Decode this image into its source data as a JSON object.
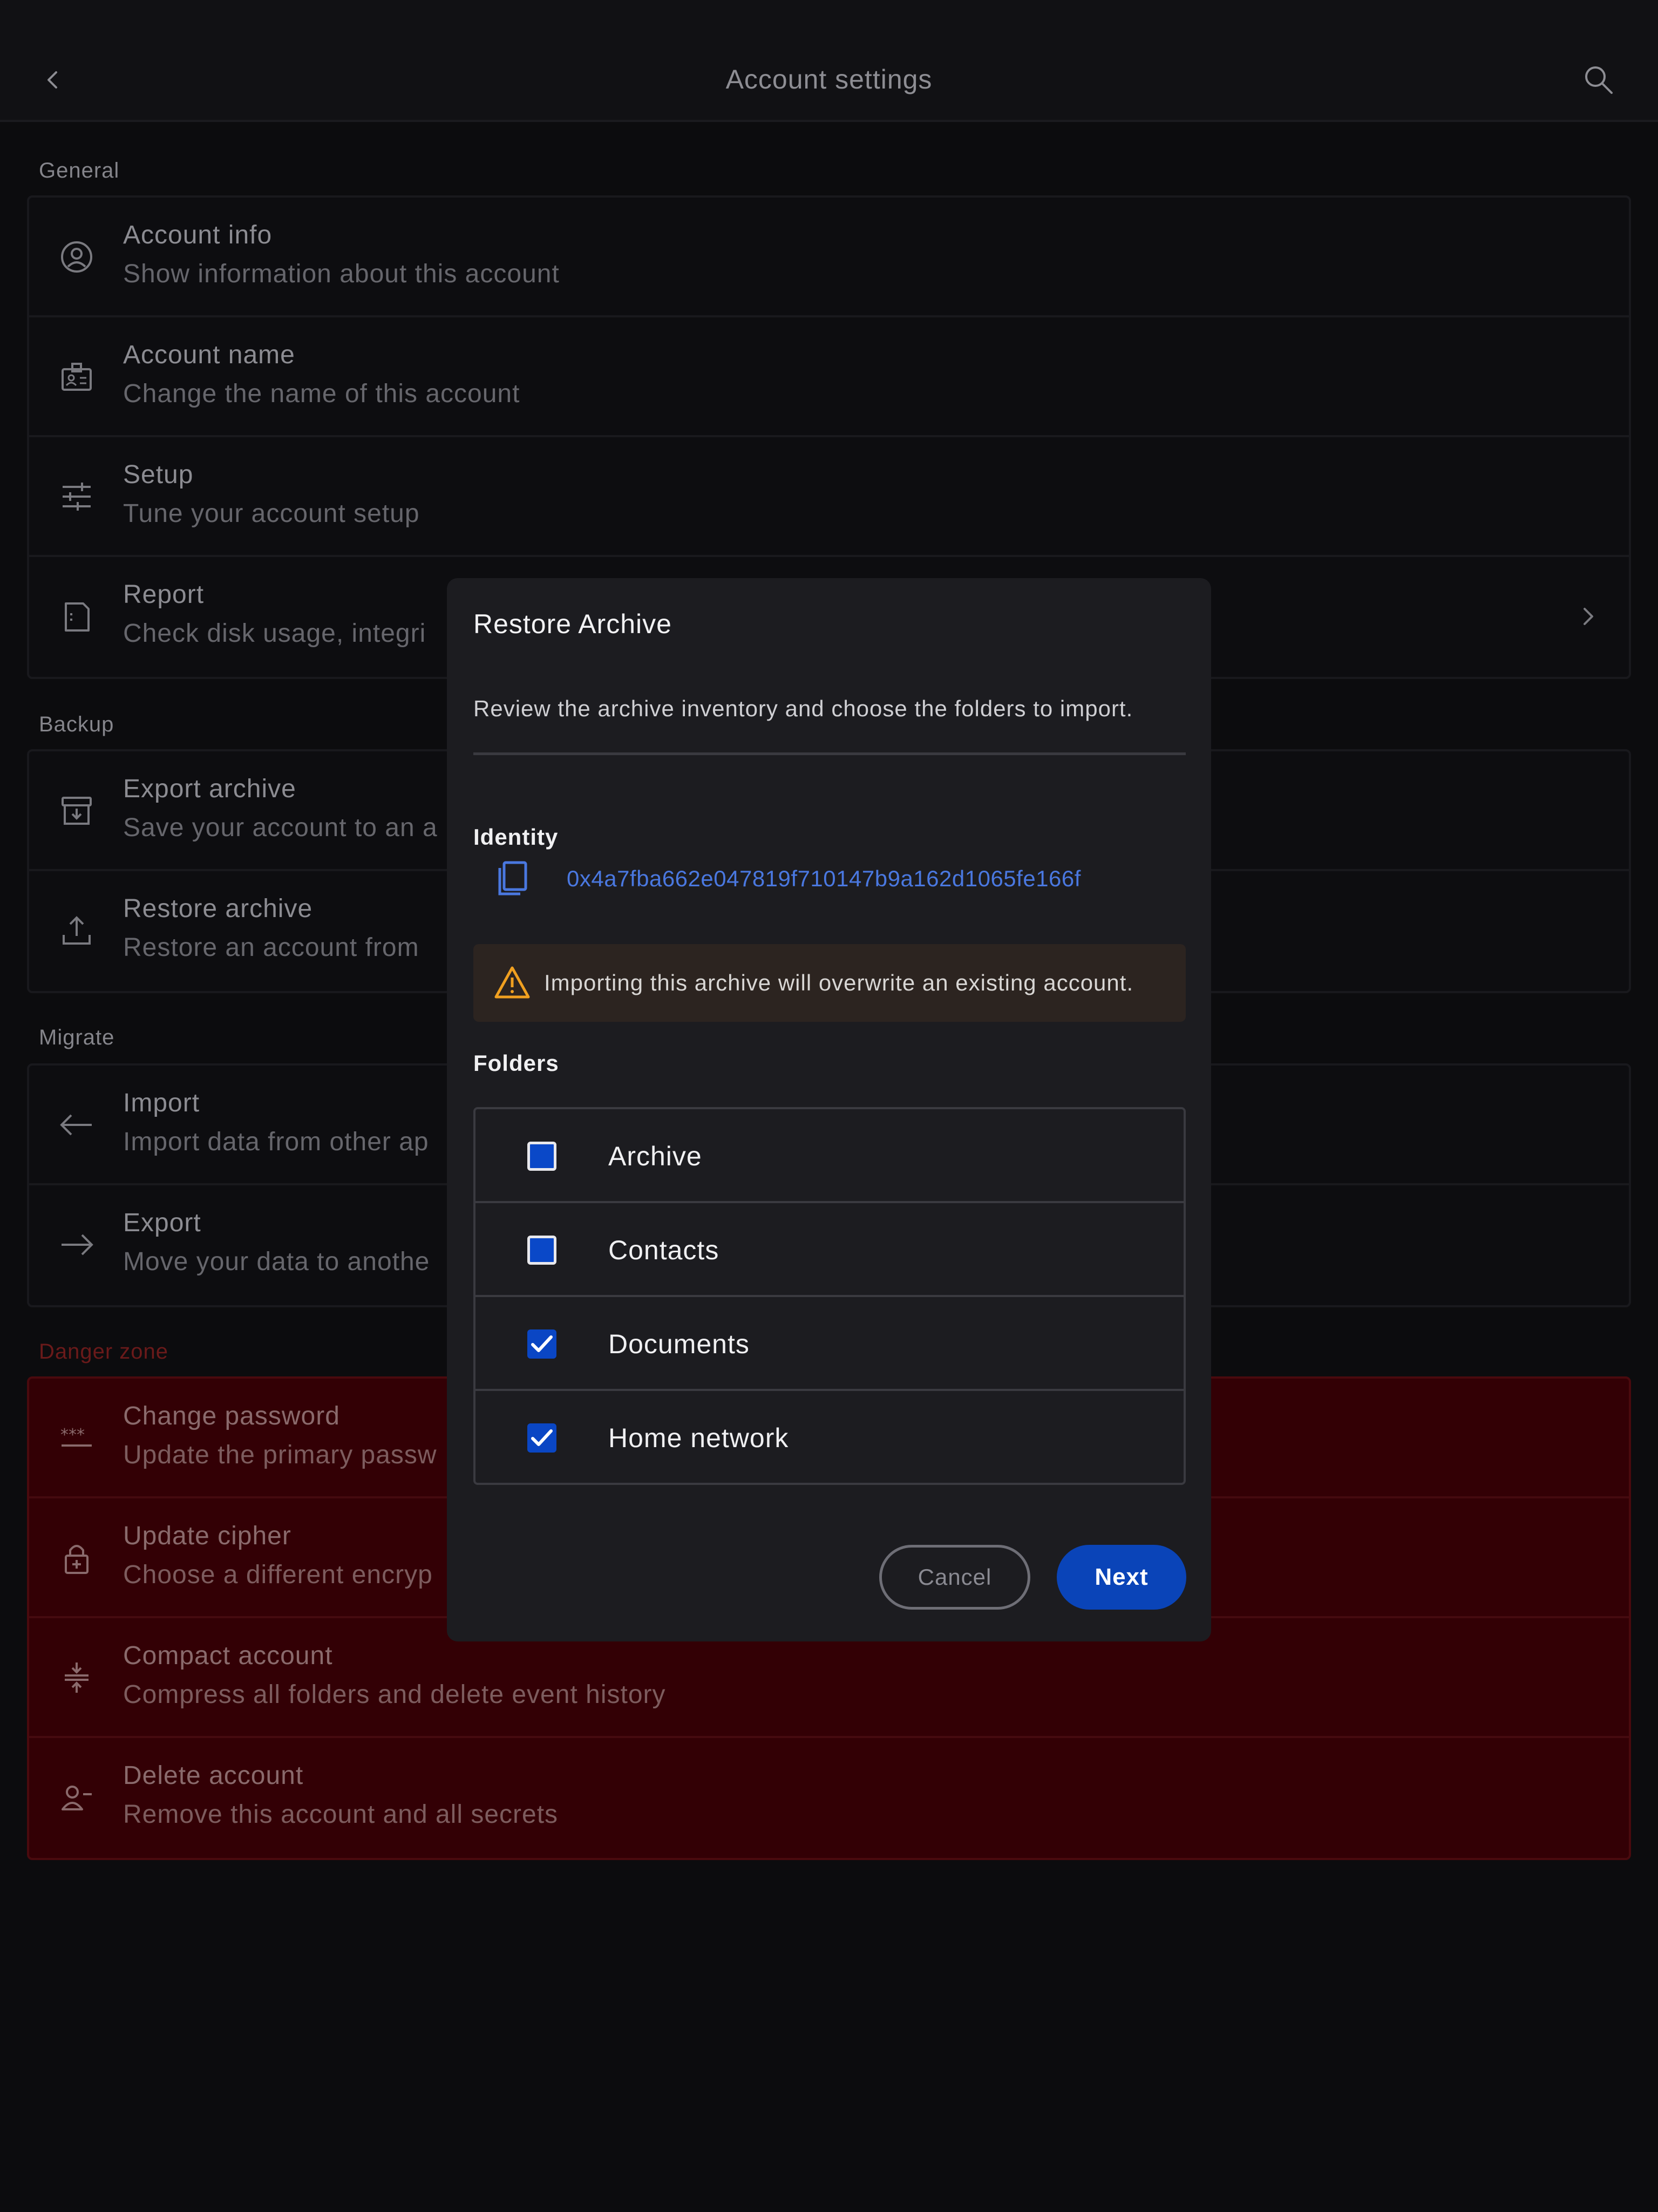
{
  "header": {
    "title": "Account settings",
    "back_icon": "chevron-left-icon",
    "search_icon": "search-icon"
  },
  "sections": {
    "general": {
      "label": "General",
      "items": [
        {
          "title": "Account info",
          "subtitle": "Show information about this account",
          "icon": "user-circle-icon"
        },
        {
          "title": "Account name",
          "subtitle": "Change the name of this account",
          "icon": "id-badge-icon"
        },
        {
          "title": "Setup",
          "subtitle": "Tune your account setup",
          "icon": "sliders-icon"
        },
        {
          "title": "Report",
          "subtitle": "Check disk usage, integri",
          "icon": "report-file-icon"
        }
      ]
    },
    "backup": {
      "label": "Backup",
      "items": [
        {
          "title": "Export archive",
          "subtitle": "Save your account to an a",
          "icon": "archive-download-icon"
        },
        {
          "title": "Restore archive",
          "subtitle": "Restore an account from",
          "icon": "upload-icon"
        }
      ]
    },
    "migrate": {
      "label": "Migrate",
      "items": [
        {
          "title": "Import",
          "subtitle": "Import data from other ap",
          "icon": "arrow-left-icon"
        },
        {
          "title": "Export",
          "subtitle": "Move your data to anothe",
          "icon": "arrow-right-icon"
        }
      ]
    },
    "danger": {
      "label": "Danger zone",
      "items": [
        {
          "title": "Change password",
          "subtitle": "Update the primary passw",
          "icon": "password-asterisks-icon"
        },
        {
          "title": "Update cipher",
          "subtitle": "Choose a different encryp",
          "icon": "lock-icon"
        },
        {
          "title": "Compact account",
          "subtitle": "Compress all folders and delete event history",
          "icon": "compress-icon"
        },
        {
          "title": "Delete account",
          "subtitle": "Remove this account and all secrets",
          "icon": "user-remove-icon"
        }
      ]
    }
  },
  "dialog": {
    "title": "Restore Archive",
    "description": "Review the archive inventory and choose the folders to import.",
    "identity_label": "Identity",
    "identity_address": "0x4a7fba662e047819f710147b9a162d1065fe166f",
    "warning": "Importing this archive will overwrite an existing account.",
    "folders_label": "Folders",
    "folders": [
      {
        "name": "Archive",
        "checked": false
      },
      {
        "name": "Contacts",
        "checked": false
      },
      {
        "name": "Documents",
        "checked": true
      },
      {
        "name": "Home network",
        "checked": true
      }
    ],
    "cancel_label": "Cancel",
    "next_label": "Next"
  },
  "colors": {
    "background": "#0c0c0e",
    "dialog_background": "#1c1c20",
    "accent_blue": "#0a44b8",
    "link_blue": "#4a78e0",
    "danger_background": "#330005",
    "warning_icon": "#f0a020"
  }
}
